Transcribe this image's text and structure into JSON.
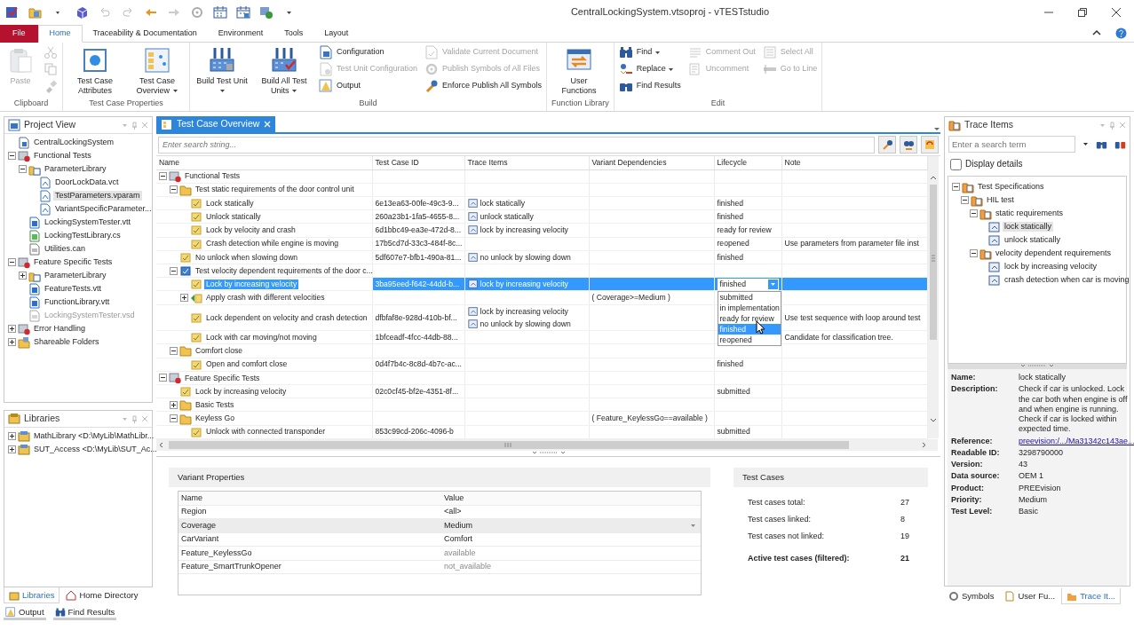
{
  "window": {
    "title": "CentralLockingSystem.vtsoproj - vTESTstudio"
  },
  "ribbon": {
    "tabs": [
      {
        "label": "File",
        "kind": "file",
        "selected": false
      },
      {
        "label": "Home",
        "kind": "tab",
        "selected": true
      },
      {
        "label": "Traceability & Documentation",
        "kind": "tab",
        "selected": false
      },
      {
        "label": "Environment",
        "kind": "tab",
        "selected": false
      },
      {
        "label": "Tools",
        "kind": "tab",
        "selected": false
      },
      {
        "label": "Layout",
        "kind": "tab",
        "selected": false
      }
    ],
    "groups": [
      {
        "label": "Clipboard",
        "columns": [
          [
            {
              "kind": "large",
              "label": "Paste",
              "disabled": true
            }
          ],
          [
            {
              "kind": "small",
              "disabled": true
            },
            {
              "kind": "small",
              "disabled": true
            },
            {
              "kind": "small",
              "disabled": true
            }
          ]
        ]
      },
      {
        "label": "Test Case Properties",
        "columns": [
          [
            {
              "kind": "large",
              "label": "Test Case Attributes",
              "disabled": false
            }
          ],
          [
            {
              "kind": "large",
              "label": "Test Case Overview",
              "disabled": false,
              "dropdown": true
            }
          ]
        ]
      },
      {
        "label": "Build",
        "columns": [
          [
            {
              "kind": "large",
              "label": "Build Test Unit",
              "disabled": false,
              "dropdown": true
            }
          ],
          [
            {
              "kind": "large",
              "label": "Build All Test Units",
              "disabled": false,
              "dropdown": true
            }
          ],
          [
            {
              "kind": "small",
              "label": "Configuration",
              "disabled": false
            },
            {
              "kind": "small",
              "label": "Test Unit Configuration",
              "disabled": true
            },
            {
              "kind": "small",
              "label": "Output",
              "disabled": false
            }
          ],
          [
            {
              "kind": "small",
              "label": "Validate Current Document",
              "disabled": true
            },
            {
              "kind": "small",
              "label": "Publish Symbols of All Files",
              "disabled": true
            },
            {
              "kind": "small",
              "label": "Enforce Publish All Symbols",
              "disabled": false
            }
          ]
        ]
      },
      {
        "label": "Function Library",
        "columns": [
          [
            {
              "kind": "large",
              "label": "User Functions",
              "disabled": false
            }
          ]
        ]
      },
      {
        "label": "Edit",
        "columns": [
          [
            {
              "kind": "small",
              "label": "Find",
              "disabled": false,
              "dropdown": true
            },
            {
              "kind": "small",
              "label": "Replace",
              "disabled": false,
              "dropdown": true
            },
            {
              "kind": "small",
              "label": "Find Results",
              "disabled": false
            }
          ],
          [
            {
              "kind": "small",
              "label": "Comment Out",
              "disabled": true
            },
            {
              "kind": "small",
              "label": "Uncomment",
              "disabled": true
            }
          ],
          [
            {
              "kind": "small",
              "label": "Select All",
              "disabled": true
            },
            {
              "kind": "small",
              "label": "Go to Line",
              "disabled": true
            }
          ]
        ]
      }
    ]
  },
  "project_view": {
    "title": "Project View",
    "tree": [
      {
        "label": "CentralLockingSystem",
        "kind": "project",
        "selected": false
      },
      {
        "label": "Functional Tests",
        "kind": "testgroup",
        "selected": false,
        "expanded": true,
        "children": [
          {
            "label": "ParameterLibrary",
            "kind": "paramlib",
            "selected": false,
            "expanded": true,
            "children": [
              {
                "label": "DoorLockData.vct",
                "kind": "paramfile",
                "selected": false
              },
              {
                "label": "TestParameters.vparam",
                "kind": "paramfile",
                "selected": true
              },
              {
                "label": "VariantSpecificParameter...",
                "kind": "paramfile",
                "selected": false
              }
            ]
          },
          {
            "label": "LockingSystemTester.vtt",
            "kind": "testunit",
            "selected": false
          },
          {
            "label": "LockingTestLibrary.cs",
            "kind": "cs",
            "selected": false
          },
          {
            "label": "Utilities.can",
            "kind": "can",
            "selected": false
          }
        ]
      },
      {
        "label": "Feature Specific Tests",
        "kind": "testgroup",
        "selected": false,
        "expanded": true,
        "children": [
          {
            "label": "ParameterLibrary",
            "kind": "paramlib",
            "selected": false,
            "expanded": false
          },
          {
            "label": "FeatureTests.vtt",
            "kind": "testunit",
            "selected": false
          },
          {
            "label": "FunctionLibrary.vtt",
            "kind": "testunit",
            "selected": false
          },
          {
            "label": "LockingSystemTester.vsd",
            "kind": "excluded",
            "selected": false
          }
        ]
      },
      {
        "label": "Error Handling",
        "kind": "testgroup",
        "selected": false,
        "expanded": false
      },
      {
        "label": "Shareable Folders",
        "kind": "shared",
        "selected": false,
        "expanded": false
      }
    ]
  },
  "libraries": {
    "title": "Libraries",
    "tree": [
      {
        "label": "MathLibrary <D:\\MyLib\\MathLibr...",
        "kind": "library",
        "selected": false,
        "expanded": false
      },
      {
        "label": "SUT_Access <D:\\MyLib\\SUT_Ac...",
        "kind": "library",
        "selected": false,
        "expanded": false
      }
    ],
    "tabs": [
      {
        "label": "Libraries",
        "selected": true
      },
      {
        "label": "Home Directory",
        "selected": false
      }
    ]
  },
  "document_tabs": [
    {
      "label": "Test Case Overview",
      "selected": true
    }
  ],
  "search": {
    "placeholder": "Enter search string..."
  },
  "table": {
    "columns": [
      "Name",
      "Test Case ID",
      "Trace Items",
      "Variant Dependencies",
      "Lifecycle",
      "Note"
    ],
    "rows": [
      {
        "name": "Functional Tests",
        "kind": "testgroup",
        "selected": false,
        "expanded": true,
        "children": [
          {
            "name": "Test static requirements of the door control unit",
            "kind": "folder",
            "selected": false,
            "expanded": true,
            "children": [
              {
                "name": "Lock statically",
                "kind": "test",
                "selected": false,
                "id": "6e13ea63-00fe-49c3-9...",
                "trace_items": [
                  "lock statically"
                ],
                "lifecycle": "finished"
              },
              {
                "name": "Unlock statically",
                "kind": "test",
                "selected": false,
                "id": "260a23b1-1fa5-4655-8...",
                "trace_items": [
                  "unlock statically"
                ],
                "lifecycle": "finished"
              },
              {
                "name": "Lock by velocity and crash",
                "kind": "test",
                "selected": false,
                "id": "6d1bbc49-ea3e-472d-8...",
                "trace_items": [
                  "lock by increasing velocity"
                ],
                "lifecycle": "ready for review"
              },
              {
                "name": "Crash detection while engine is moving",
                "kind": "test",
                "selected": false,
                "id": "17b5cd7d-33c3-484f-8c...",
                "lifecycle": "reopened",
                "note": "Use parameters from parameter file inst"
              }
            ]
          },
          {
            "name": "No unlock when slowing down",
            "kind": "test",
            "selected": false,
            "id": "5df607e7-bfb1-490a-81...",
            "trace_items": [
              "no unlock by slowing down"
            ],
            "lifecycle": "finished"
          },
          {
            "name": "Test velocity dependent requirements of the door c...",
            "kind": "testset",
            "selected": false,
            "expanded": true,
            "children": [
              {
                "name": "Lock by increasing velocity",
                "kind": "test",
                "selected": true,
                "id": "3ba95eed-f642-44dd-b...",
                "trace_items": [
                  "lock by increasing velocity"
                ],
                "lifecycle": "finished",
                "lifecycle_options": [
                  {
                    "label": "submitted",
                    "selected": false
                  },
                  {
                    "label": "in implementation",
                    "selected": false
                  },
                  {
                    "label": "ready for review",
                    "selected": false
                  },
                  {
                    "label": "finished",
                    "selected": true
                  },
                  {
                    "label": "reopened",
                    "selected": false
                  }
                ]
              },
              {
                "name": "Apply crash with different velocities",
                "kind": "testgen",
                "selected": false,
                "expanded": false,
                "variant": "( Coverage>=Medium )"
              },
              {
                "name": "Lock dependent on velocity and crash detection",
                "kind": "test",
                "selected": false,
                "id": "dfbfaf8e-928d-410b-bf...",
                "trace_items": [
                  "lock by increasing velocity",
                  "no unlock by slowing down"
                ],
                "note": "Use test sequence with loop around test"
              },
              {
                "name": "Lock with car moving/not moving",
                "kind": "test",
                "selected": false,
                "id": "1bfceadf-4fcc-44db-88...",
                "note": "Candidate for classification tree."
              }
            ]
          },
          {
            "name": "Comfort close",
            "kind": "folder",
            "selected": false,
            "expanded": true,
            "children": [
              {
                "name": "Open and comfort close",
                "kind": "test",
                "selected": false,
                "id": "0d4f7b4c-8c8d-4b7c-ac...",
                "lifecycle": "finished"
              }
            ]
          }
        ]
      },
      {
        "name": "Feature Specific Tests",
        "kind": "testgroup",
        "selected": false,
        "expanded": true,
        "children": [
          {
            "name": "Lock by increasing velocity",
            "kind": "test",
            "selected": false,
            "id": "02c0cf45-bf2e-4351-8f...",
            "lifecycle": "submitted"
          },
          {
            "name": "Basic Tests",
            "kind": "folder",
            "selected": false,
            "expanded": false
          },
          {
            "name": "Keyless Go",
            "kind": "folder",
            "selected": false,
            "expanded": true,
            "variant": "( Feature_KeylessGo==available )",
            "children": [
              {
                "name": "Unlock with connected transponder",
                "kind": "test",
                "selected": false,
                "id": "853c99cd-206c-4096-b",
                "lifecycle": "submitted"
              }
            ]
          }
        ]
      }
    ]
  },
  "variant_properties": {
    "title": "Variant Properties",
    "columns": [
      "Name",
      "Value"
    ],
    "rows": [
      {
        "name": "Region",
        "value": "<all>",
        "selected": false,
        "editable": true
      },
      {
        "name": "Coverage",
        "value": "Medium",
        "selected": true,
        "editable": true
      },
      {
        "name": "CarVariant",
        "value": "Comfort",
        "selected": false,
        "editable": true
      },
      {
        "name": "Feature_KeylessGo",
        "value": "available",
        "selected": false,
        "editable": false
      },
      {
        "name": "Feature_SmartTrunkOpener",
        "value": "not_available",
        "selected": false,
        "editable": false
      }
    ]
  },
  "test_cases": {
    "title": "Test Cases",
    "stats": [
      {
        "label": "Test cases total:",
        "value": "27",
        "kind": "count"
      },
      {
        "label": "Test cases linked:",
        "value": "8",
        "kind": "count"
      },
      {
        "label": "Test cases not linked:",
        "value": "19",
        "kind": "count"
      },
      {
        "label": "Active test cases (filtered):",
        "value": "21",
        "kind": "total"
      }
    ]
  },
  "trace_items": {
    "title": "Trace Items",
    "search": {
      "placeholder": "Enter a search term"
    },
    "display_details": {
      "label": "Display details",
      "checked": false
    },
    "tree": [
      {
        "label": "Test Specifications",
        "kind": "spec",
        "selected": false,
        "expanded": true,
        "children": [
          {
            "label": "HIL test",
            "kind": "spec",
            "selected": false,
            "expanded": true,
            "children": [
              {
                "label": "static requirements",
                "kind": "spec",
                "selected": false,
                "expanded": true,
                "children": [
                  {
                    "label": "lock statically",
                    "kind": "requirement",
                    "selected": true
                  },
                  {
                    "label": "unlock statically",
                    "kind": "requirement",
                    "selected": false
                  }
                ]
              },
              {
                "label": "velocity dependent requirements",
                "kind": "spec",
                "selected": false,
                "expanded": true,
                "children": [
                  {
                    "label": "lock by increasing velocity",
                    "kind": "requirement",
                    "selected": false
                  },
                  {
                    "label": "crash detection when car is moving",
                    "kind": "requirement",
                    "selected": false
                  }
                ]
              }
            ]
          }
        ]
      }
    ],
    "details": [
      {
        "label": "Name:",
        "value": "lock statically",
        "kind": "text"
      },
      {
        "label": "Description:",
        "value": "Check if car is unlocked. Lock the car both when engine is off and when engine is running. Check if car is locked within expected time.",
        "kind": "text"
      },
      {
        "label": "Reference:",
        "value": "preevision:/.../Ma31342c143ae...",
        "kind": "link"
      },
      {
        "label": "Readable ID:",
        "value": "3298790000",
        "kind": "text"
      },
      {
        "label": "Version:",
        "value": "43",
        "kind": "text"
      },
      {
        "label": "Data source:",
        "value": "OEM 1",
        "kind": "text"
      },
      {
        "label": "Product:",
        "value": "PREEvision",
        "kind": "text"
      },
      {
        "label": "Priority:",
        "value": "Medium",
        "kind": "text"
      },
      {
        "label": "Test Level:",
        "value": "Basic",
        "kind": "text"
      }
    ],
    "tabs": [
      {
        "label": "Symbols",
        "selected": false
      },
      {
        "label": "User Fu...",
        "selected": false
      },
      {
        "label": "Trace It...",
        "selected": true
      }
    ]
  },
  "bottom_tabs": [
    {
      "label": "Output"
    },
    {
      "label": "Find Results"
    }
  ]
}
